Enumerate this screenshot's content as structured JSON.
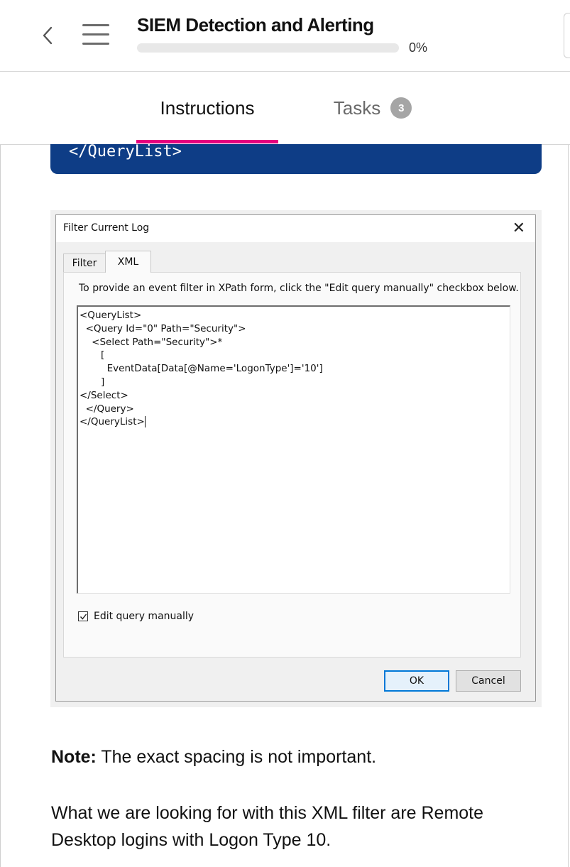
{
  "header": {
    "title": "SIEM Detection and Alerting",
    "progress_percent": 0,
    "progress_label": "0%"
  },
  "tabs": {
    "instructions_label": "Instructions",
    "tasks_label": "Tasks",
    "tasks_count": "3"
  },
  "code_block": {
    "visible_line": "</QueryList>"
  },
  "dialog": {
    "title": "Filter Current Log",
    "tab_filter": "Filter",
    "tab_xml": "XML",
    "instruction": "To provide an event filter in XPath form, click the \"Edit query manually\" checkbox below.",
    "xml_lines": [
      "<QueryList>",
      "  <Query Id=\"0\" Path=\"Security\">",
      "    <Select Path=\"Security\">*",
      "       [",
      "         EventData[Data[@Name='LogonType']='10']",
      "       ]",
      "</Select>",
      "  </Query>",
      "</QueryList>"
    ],
    "checkbox_label": "Edit query manually",
    "checkbox_checked": true,
    "ok_label": "OK",
    "cancel_label": "Cancel"
  },
  "content": {
    "note_bold": "Note:",
    "note_text": " The exact spacing is not important.",
    "paragraph": "What we are looking for with this XML filter are Remote Desktop logins with Logon Type 10."
  },
  "colors": {
    "accent": "#e6007e",
    "code_bg": "#0e3d86",
    "badge_bg": "#a5a5a5"
  }
}
